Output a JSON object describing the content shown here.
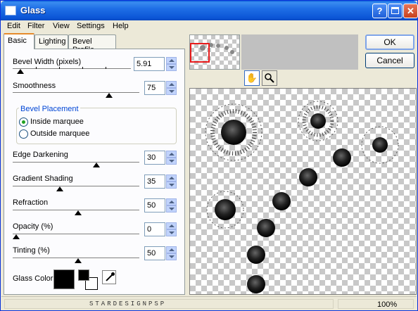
{
  "window": {
    "title": "Glass"
  },
  "menu": [
    "Edit",
    "Filter",
    "View",
    "Settings",
    "Help"
  ],
  "tabs": [
    "Basic",
    "Lighting",
    "Bevel Profile"
  ],
  "controls": {
    "bevel_width": {
      "label": "Bevel Width (pixels)",
      "value": "5.91",
      "level": 0.04
    },
    "smoothness": {
      "label": "Smoothness",
      "value": "75",
      "level": 0.75
    },
    "edge_darkening": {
      "label": "Edge Darkening",
      "value": "30",
      "level": 0.3
    },
    "gradient_shading": {
      "label": "Gradient Shading",
      "value": "35",
      "level": 0.35
    },
    "refraction": {
      "label": "Refraction",
      "value": "50",
      "level": 0.5
    },
    "opacity": {
      "label": "Opacity (%)",
      "value": "0",
      "level": 0.0
    },
    "tinting": {
      "label": "Tinting (%)",
      "value": "50",
      "level": 0.5
    }
  },
  "bevel_placement": {
    "title": "Bevel Placement",
    "options": [
      "Inside marquee",
      "Outside marquee"
    ],
    "selected": "Inside marquee"
  },
  "glass_color": {
    "label": "Glass Color",
    "color": "#000000"
  },
  "buttons": {
    "ok": "OK",
    "cancel": "Cancel"
  },
  "tools": {
    "pan": "pan-hand-icon",
    "zoom": "zoom-magnifier-icon"
  },
  "status": {
    "watermark": "STARDESIGNPSP",
    "zoom": "100%"
  }
}
